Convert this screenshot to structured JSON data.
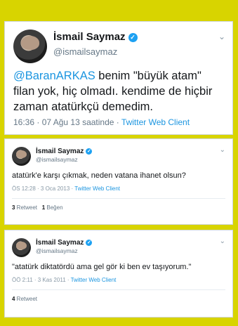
{
  "tweets": [
    {
      "name": "İsmail Saymaz",
      "handle": "@ismailsaymaz",
      "mention": "@BaranARKAS",
      "text": " benim \"büyük atam\" filan yok, hiç olmadı. kendime de hiçbir zaman atatürkçü demedim.",
      "time": "16:36 · 07 Ağu 13 saatinde · ",
      "client": "Twitter Web Client"
    },
    {
      "name": "İsmail Saymaz",
      "handle": "@ismailsaymaz",
      "text": "atatürk'e karşı çıkmak, neden vatana ihanet olsun?",
      "time": "ÖS 12:28 · 3 Oca 2013 · ",
      "client": "Twitter Web Client",
      "retweets_count": "3",
      "retweets_label": " Retweet",
      "likes_count": "1",
      "likes_label": " Beğen"
    },
    {
      "name": "İsmail Saymaz",
      "handle": "@ismailsaymaz",
      "text": "\"atatürk diktatördü ama gel gör ki ben ev taşıyorum.\"",
      "time": "ÖÖ 2:11 · 3 Kas 2011 · ",
      "client": "Twitter Web Client",
      "retweets_count": "4",
      "retweets_label": " Retweet"
    }
  ],
  "icons": {
    "verified": "verified-badge-icon",
    "menu": "chevron-down-icon"
  },
  "colors": {
    "background": "#d8d400",
    "link": "#1b95e0",
    "verified": "#1da1f2"
  }
}
